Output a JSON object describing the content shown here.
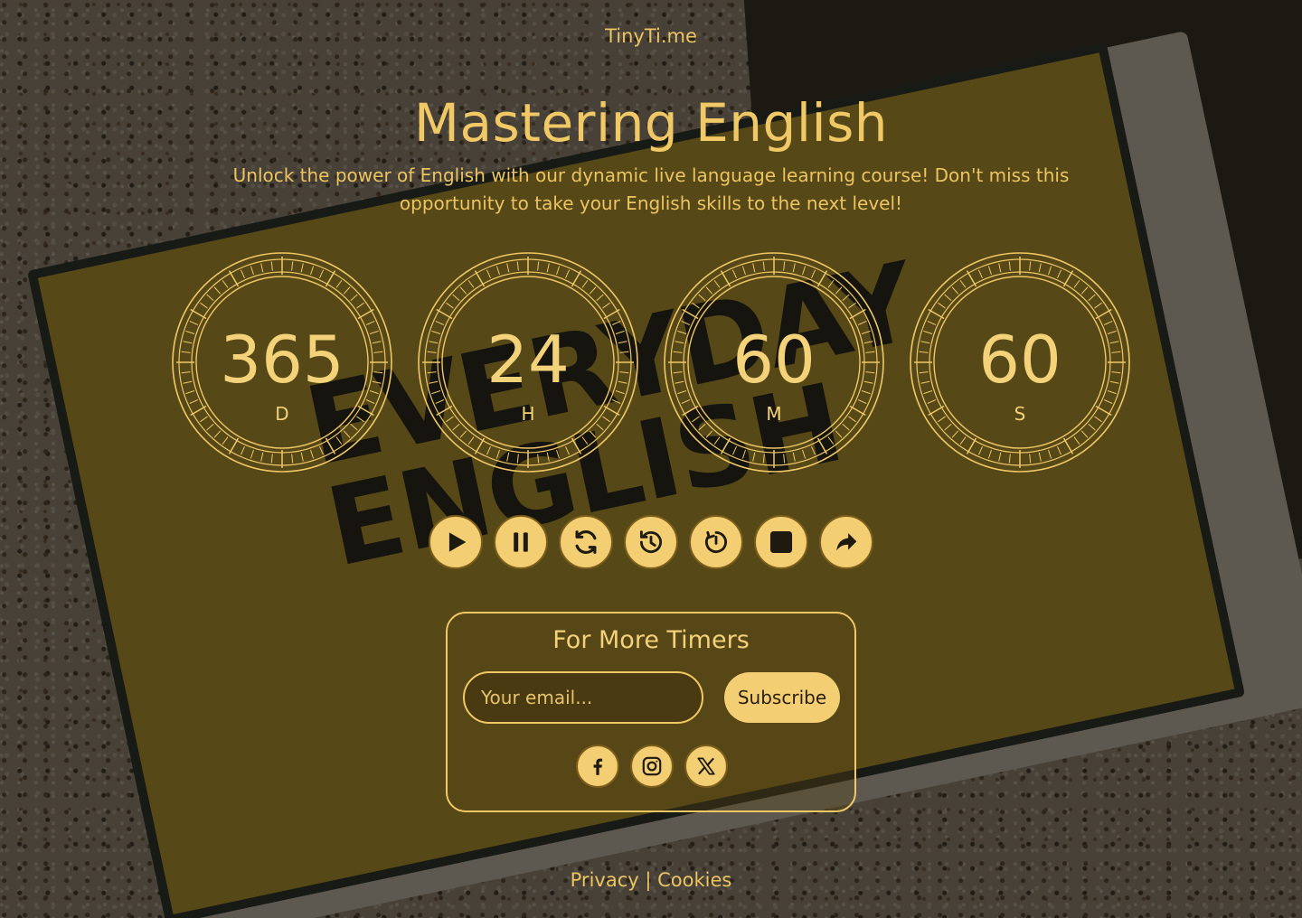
{
  "brand": "TinyTi.me",
  "title": "Mastering English",
  "subtitle": "Unlock the power of English with our dynamic live language learning course! Don't miss this opportunity to take your English skills to the next level!",
  "timers": [
    {
      "value": "365",
      "unit": "D"
    },
    {
      "value": "24",
      "unit": "H"
    },
    {
      "value": "60",
      "unit": "M"
    },
    {
      "value": "60",
      "unit": "S"
    }
  ],
  "controls": [
    "play-icon",
    "pause-icon",
    "refresh-icon",
    "history-icon",
    "timer-reset-icon",
    "stop-icon",
    "share-icon"
  ],
  "newsletter": {
    "title": "For More Timers",
    "email_placeholder": "Your email...",
    "subscribe_label": "Subscribe"
  },
  "social": [
    "facebook-icon",
    "instagram-icon",
    "x-icon"
  ],
  "footer": {
    "privacy": "Privacy",
    "separator": "|",
    "cookies": "Cookies"
  },
  "colors": {
    "accent": "#f0c866",
    "button_fill": "#f3ce72",
    "icon_dark": "#1e1a10"
  }
}
